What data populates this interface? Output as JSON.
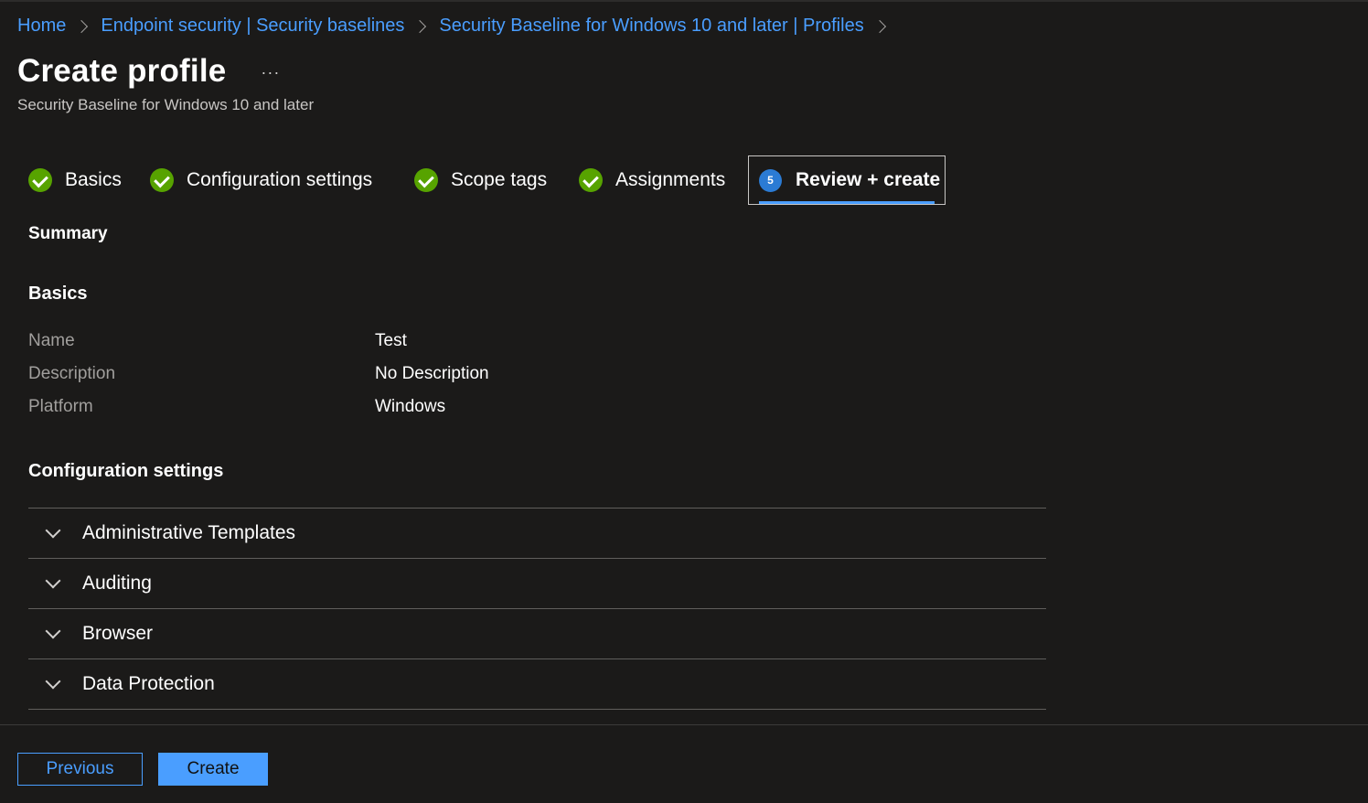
{
  "breadcrumb": {
    "items": [
      "Home",
      "Endpoint security | Security baselines",
      "Security Baseline for Windows 10 and later | Profiles"
    ]
  },
  "header": {
    "title": "Create profile",
    "more_label": "···",
    "subtitle": "Security Baseline for Windows 10 and later"
  },
  "wizard": {
    "steps": [
      {
        "label": "Basics",
        "status": "complete"
      },
      {
        "label": "Configuration settings",
        "status": "complete"
      },
      {
        "label": "Scope tags",
        "status": "complete"
      },
      {
        "label": "Assignments",
        "status": "complete"
      },
      {
        "label": "Review + create",
        "status": "active",
        "number": "5"
      }
    ]
  },
  "summary": {
    "heading": "Summary",
    "basics": {
      "heading": "Basics",
      "rows": [
        {
          "label": "Name",
          "value": "Test"
        },
        {
          "label": "Description",
          "value": "No Description"
        },
        {
          "label": "Platform",
          "value": "Windows"
        }
      ]
    },
    "configuration": {
      "heading": "Configuration settings",
      "sections": [
        "Administrative Templates",
        "Auditing",
        "Browser",
        "Data Protection"
      ]
    }
  },
  "footer": {
    "previous_label": "Previous",
    "create_label": "Create"
  },
  "colors": {
    "background": "#1b1a19",
    "link": "#4a9eff",
    "check": "#57a300",
    "step_number": "#2b7bd4"
  }
}
